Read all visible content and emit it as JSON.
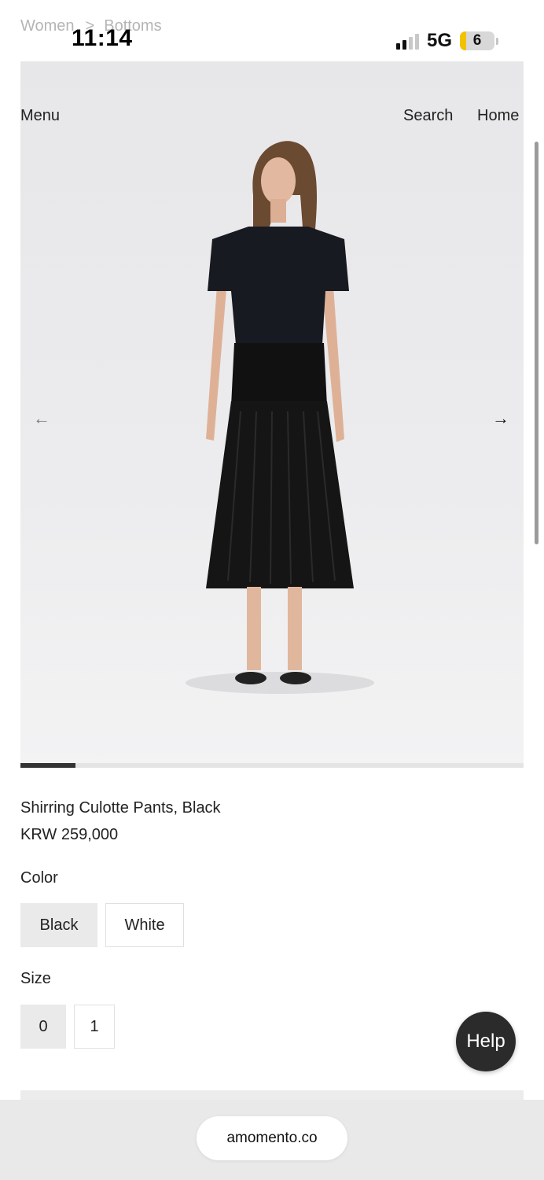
{
  "status_bar": {
    "time": "11:14",
    "network": "5G",
    "battery": "6"
  },
  "breadcrumb": {
    "items": [
      "Women",
      "Bottoms"
    ],
    "separator": ">"
  },
  "nav": {
    "menu": "Menu",
    "search": "Search",
    "home": "Home"
  },
  "gallery": {
    "prev_icon": "arrow-left-icon",
    "next_icon": "arrow-right-icon",
    "prev_glyph": "←",
    "next_glyph": "→",
    "progress": 0.11
  },
  "product": {
    "name": "Shirring Culotte Pants, Black",
    "price": "KRW 259,000"
  },
  "color": {
    "label": "Color",
    "options": [
      "Black",
      "White"
    ],
    "selected": "Black"
  },
  "size": {
    "label": "Size",
    "options": [
      "0",
      "1"
    ],
    "selected": "0"
  },
  "help": {
    "label": "Help"
  },
  "browser": {
    "url": "amomento.co"
  },
  "colors": {
    "accent": "#2b2b2b",
    "selected_bg": "#eaeaea",
    "background": "#ffffff"
  }
}
